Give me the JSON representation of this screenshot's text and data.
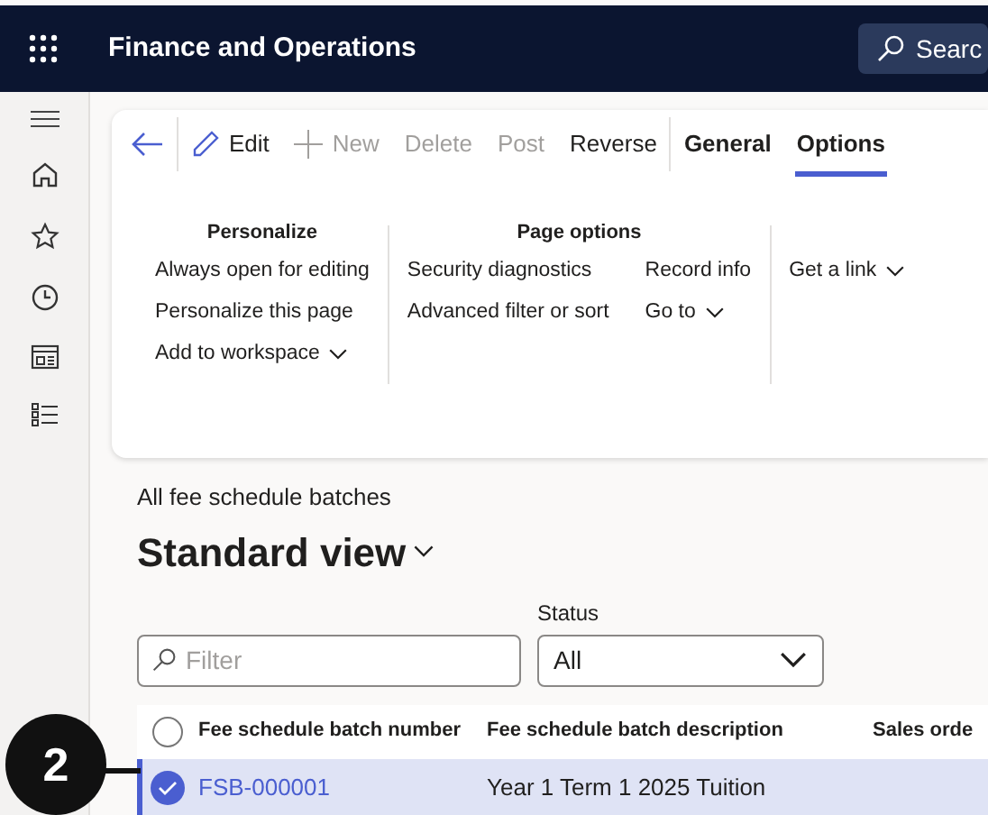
{
  "app_bar": {
    "title": "Finance and Operations",
    "search_placeholder": "Searc"
  },
  "action_pane": {
    "actions": [
      {
        "kind": "back",
        "disabled": false
      },
      {
        "kind": "edit",
        "label": "Edit",
        "disabled": false
      },
      {
        "kind": "new",
        "label": "New",
        "disabled": true
      },
      {
        "kind": "plain",
        "label": "Delete",
        "disabled": true
      },
      {
        "kind": "plain",
        "label": "Post",
        "disabled": true
      },
      {
        "kind": "plain",
        "label": "Reverse",
        "disabled": false
      }
    ],
    "tabs": [
      {
        "label": "General",
        "selected": false
      },
      {
        "label": "Options",
        "selected": true
      }
    ],
    "groups": [
      {
        "title": "Personalize",
        "columns": [
          [
            {
              "label": "Always open for editing",
              "dropdown": false
            },
            {
              "label": "Personalize this page",
              "dropdown": false
            },
            {
              "label": "Add to workspace",
              "dropdown": true
            }
          ]
        ]
      },
      {
        "title": "Page options",
        "columns": [
          [
            {
              "label": "Security diagnostics",
              "dropdown": false
            },
            {
              "label": "Advanced filter or sort",
              "dropdown": false
            }
          ],
          [
            {
              "label": "Record info",
              "dropdown": false
            },
            {
              "label": "Go to",
              "dropdown": true
            }
          ]
        ]
      },
      {
        "columns": [
          [
            {
              "label": "Get a link",
              "dropdown": true
            }
          ]
        ]
      }
    ]
  },
  "page": {
    "caption": "All fee schedule batches",
    "view": "Standard view",
    "filter_placeholder": "Filter",
    "status_label": "Status",
    "status_value": "All"
  },
  "grid": {
    "select_all": {
      "checked": false
    },
    "columns": [
      "Fee schedule batch number",
      "Fee schedule batch description",
      "Sales orde"
    ],
    "rows": [
      {
        "selected": true,
        "cells": [
          "FSB-000001",
          "Year 1 Term 1 2025 Tuition"
        ]
      }
    ]
  },
  "callout": {
    "number": "2"
  }
}
